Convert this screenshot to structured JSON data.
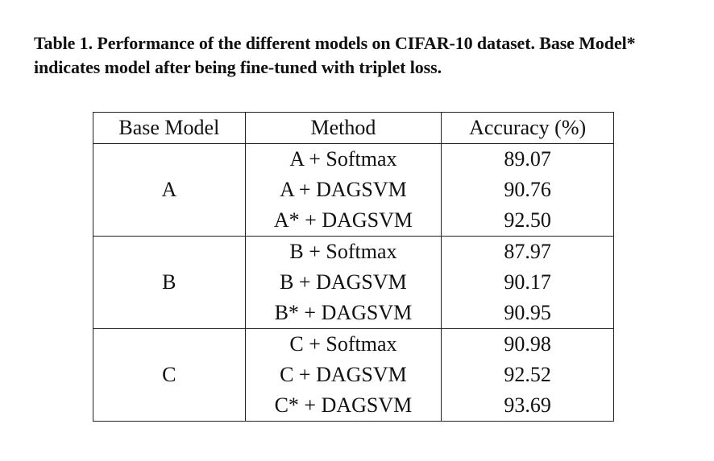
{
  "caption": {
    "label": "Table 1.",
    "text": "Performance of the different models on CIFAR-10 dataset.  Base Model* indicates model after being fine-tuned with triplet loss."
  },
  "table": {
    "headers": [
      "Base Model",
      "Method",
      "Accuracy (%)"
    ],
    "groups": [
      {
        "base": "A",
        "rows": [
          {
            "method": "A + Softmax",
            "accuracy": "89.07"
          },
          {
            "method": "A + DAGSVM",
            "accuracy": "90.76"
          },
          {
            "method": "A* + DAGSVM",
            "accuracy": "92.50"
          }
        ]
      },
      {
        "base": "B",
        "rows": [
          {
            "method": "B + Softmax",
            "accuracy": "87.97"
          },
          {
            "method": "B + DAGSVM",
            "accuracy": "90.17"
          },
          {
            "method": "B* + DAGSVM",
            "accuracy": "90.95"
          }
        ]
      },
      {
        "base": "C",
        "rows": [
          {
            "method": "C + Softmax",
            "accuracy": "90.98"
          },
          {
            "method": "C + DAGSVM",
            "accuracy": "92.52"
          },
          {
            "method": "C* + DAGSVM",
            "accuracy": "93.69"
          }
        ]
      }
    ]
  }
}
